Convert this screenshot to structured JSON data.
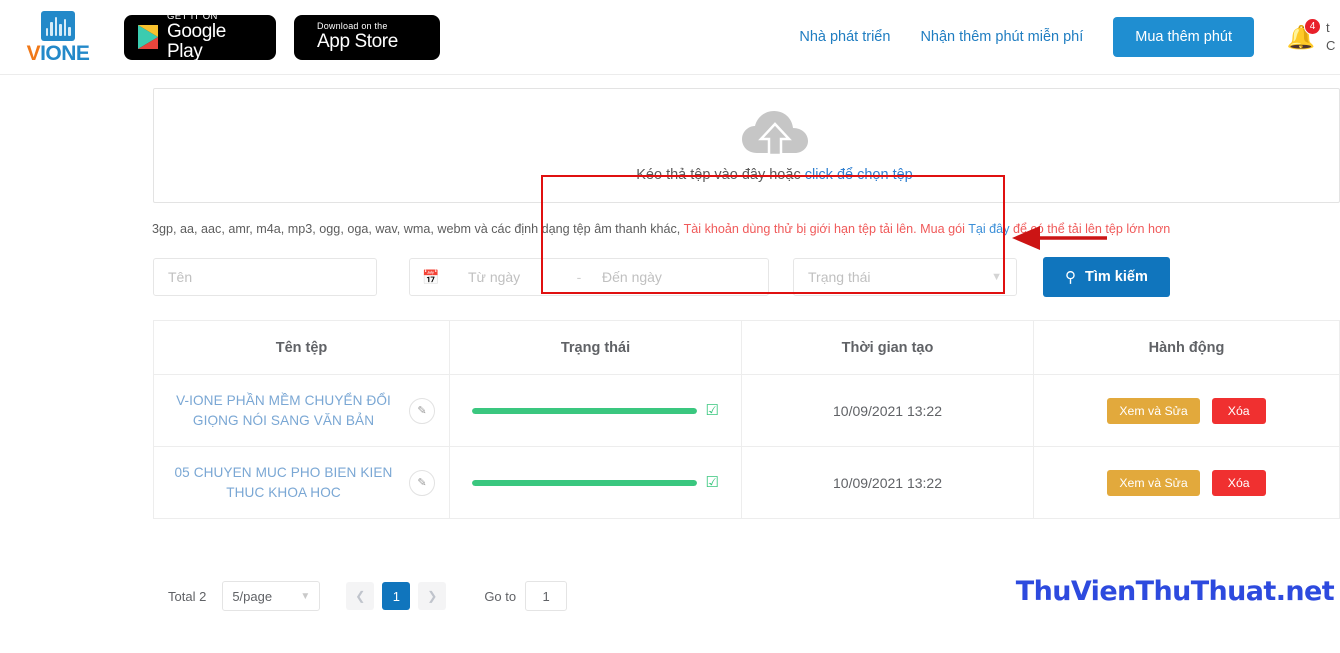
{
  "header": {
    "logo": {
      "v": "V",
      "ione": "IONE",
      "icon": "waveform-icon"
    },
    "google_play": {
      "small": "GET IT ON",
      "big": "Google Play"
    },
    "app_store": {
      "small": "Download on the",
      "big": "App Store"
    },
    "nav": [
      {
        "label": "Nhà phát triển",
        "name": "nav-developer"
      },
      {
        "label": "Nhận thêm phút miễn phí",
        "name": "nav-free-minutes"
      }
    ],
    "buy_button": "Mua thêm phút",
    "notification": {
      "icon": "bell-icon",
      "count": "4"
    },
    "user_clipped": "t\nC"
  },
  "upload": {
    "icon": "cloud-upload-icon",
    "text_prefix": "Kéo thả tệp vào đây hoặc ",
    "link": "click để chọn tệp",
    "formats_prefix": "3gp, aa, aac, amr, m4a, mp3, ogg, oga, wav, wma, webm và các định dạng tệp âm thanh khác, ",
    "formats_warn": "Tài khoản dùng thử bị giới hạn tệp tải lên. Mua gói ",
    "formats_link": "Tại đây",
    "formats_suffix": " để có thể tải lên tệp lớn hơn",
    "highlight_color": "#e01010",
    "arrow_color": "#cc1414"
  },
  "filters": {
    "name_placeholder": "Tên",
    "calendar_icon": "calendar-icon",
    "date_from_placeholder": "Từ ngày",
    "date_separator": "-",
    "date_to_placeholder": "Đến ngày",
    "status_placeholder": "Trạng thái",
    "status_chevron": "chevron-down-icon",
    "search_icon": "search-icon",
    "search_label": "Tìm kiếm"
  },
  "table": {
    "columns": [
      "Tên tệp",
      "Trạng thái",
      "Thời gian tạo",
      "Hành động"
    ],
    "rows": [
      {
        "filename": "V-IONE PHẦN MỀM CHUYỂN ĐỔI GIỌNG NÓI SANG VĂN BẢN",
        "edit_icon": "pencil-icon",
        "progress": 100,
        "status_icon": "check-circle-icon",
        "created": "10/09/2021 13:22",
        "view_edit": "Xem và Sửa",
        "delete": "Xóa"
      },
      {
        "filename": "05 CHUYEN MUC PHO BIEN KIEN THUC KHOA HOC",
        "edit_icon": "pencil-icon",
        "progress": 100,
        "status_icon": "check-circle-icon",
        "created": "10/09/2021 13:22",
        "view_edit": "Xem và Sửa",
        "delete": "Xóa"
      }
    ]
  },
  "pagination": {
    "total": "Total 2",
    "page_size": "5/page",
    "prev_icon": "chevron-left-icon",
    "current_page": "1",
    "next_icon": "chevron-right-icon",
    "goto_label": "Go to",
    "goto_value": "1"
  },
  "watermark": "ThuVienThuThuat.net"
}
